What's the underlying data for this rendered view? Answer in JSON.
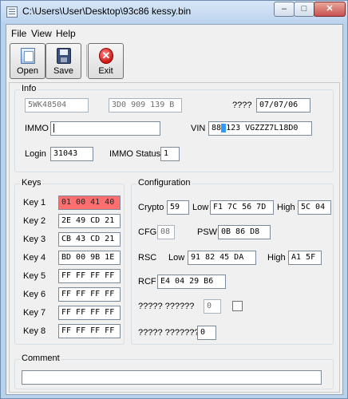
{
  "window": {
    "title": "C:\\Users\\User\\Desktop\\93c86 kessy.bin",
    "min_label": "–",
    "max_label": "□",
    "close_label": "✕"
  },
  "menu": {
    "file": "File",
    "view": "View",
    "help": "Help"
  },
  "toolbar": {
    "open_label": "Open",
    "save_label": "Save",
    "exit_label": "Exit",
    "exit_glyph": "✕"
  },
  "info": {
    "legend": "Info",
    "part_number": "5WK48504",
    "vw_number": "3D0 909 139 B",
    "date_label": "????",
    "date": "07/07/06",
    "immo_label": "IMMO",
    "immo_value": "",
    "vin_label": "VIN",
    "vin_prefix": "88",
    "vin_selected": " ",
    "vin_suffix": "123 VGZZZ7L18D0",
    "login_label": "Login",
    "login": "31043",
    "immo_status_label": "IMMO Status",
    "immo_status": "1"
  },
  "keys": {
    "legend": "Keys",
    "items": [
      {
        "label": "Key 1",
        "value": "01 00 41 40"
      },
      {
        "label": "Key 2",
        "value": "2E 49 CD 21"
      },
      {
        "label": "Key 3",
        "value": "CB 43 CD 21"
      },
      {
        "label": "Key 4",
        "value": "BD 00 9B 1E"
      },
      {
        "label": "Key 5",
        "value": "FF FF FF FF"
      },
      {
        "label": "Key 6",
        "value": "FF FF FF FF"
      },
      {
        "label": "Key 7",
        "value": "FF FF FF FF"
      },
      {
        "label": "Key 8",
        "value": "FF FF FF FF"
      }
    ]
  },
  "config": {
    "legend": "Configuration",
    "crypto_label": "Crypto",
    "crypto": "59",
    "low_label": "Low",
    "crypto_low": "F1 7C 56 7D",
    "high_label": "High",
    "crypto_high": "5C 04",
    "cfg_label": "CFG",
    "cfg": "08",
    "psw_label": "PSW",
    "psw": "0B 86 D8",
    "rsc_label": "RSC",
    "rsc_low_label": "Low",
    "rsc_low": "91 82 45 DA",
    "rsc_high_label": "High",
    "rsc_high": "A1 5F",
    "rcf_label": "RCF",
    "rcf": "E4 04 29 B6",
    "q1_label": "????? ??????",
    "q1_value": "0",
    "q2_label": "????? ???????",
    "q2_value": "0"
  },
  "comment": {
    "legend": "Comment",
    "value": ""
  }
}
